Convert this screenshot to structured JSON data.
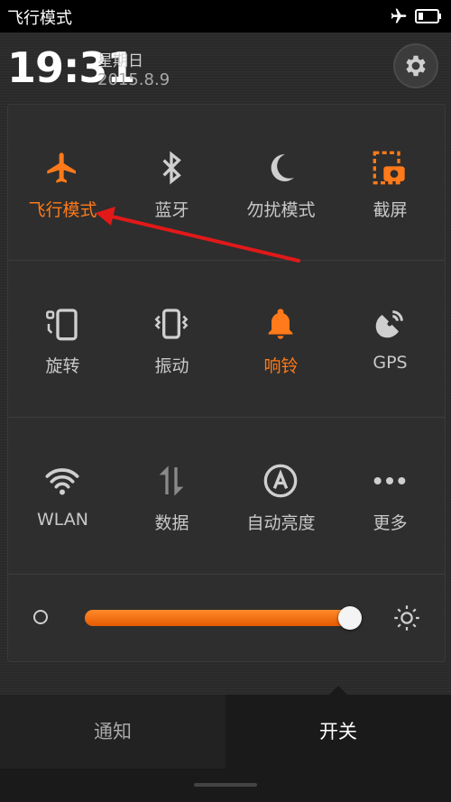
{
  "status_bar": {
    "title": "飞行模式",
    "icons": [
      "airplane-icon",
      "battery-icon"
    ]
  },
  "header": {
    "time": "19:31",
    "weekday": "星期日",
    "date": "2015.8.9",
    "settings_icon": "gear-icon"
  },
  "accent_color": "#ff7a1a",
  "toggles": [
    {
      "label": "飞行模式",
      "icon": "airplane-icon",
      "active": true
    },
    {
      "label": "蓝牙",
      "icon": "bluetooth-icon",
      "active": false
    },
    {
      "label": "勿扰模式",
      "icon": "moon-icon",
      "active": false
    },
    {
      "label": "截屏",
      "icon": "screenshot-icon",
      "active": false
    },
    {
      "label": "旋转",
      "icon": "rotation-lock-icon",
      "active": false
    },
    {
      "label": "振动",
      "icon": "vibrate-icon",
      "active": false
    },
    {
      "label": "响铃",
      "icon": "bell-icon",
      "active": true
    },
    {
      "label": "GPS",
      "icon": "gps-icon",
      "active": false
    },
    {
      "label": "WLAN",
      "icon": "wifi-icon",
      "active": false
    },
    {
      "label": "数据",
      "icon": "mobile-data-icon",
      "active": false
    },
    {
      "label": "自动亮度",
      "icon": "auto-brightness-icon",
      "active": false
    },
    {
      "label": "更多",
      "icon": "more-icon",
      "active": false
    }
  ],
  "brightness": {
    "level_percent": 100
  },
  "tabs": [
    {
      "label": "通知",
      "selected": false
    },
    {
      "label": "开关",
      "selected": true
    }
  ]
}
